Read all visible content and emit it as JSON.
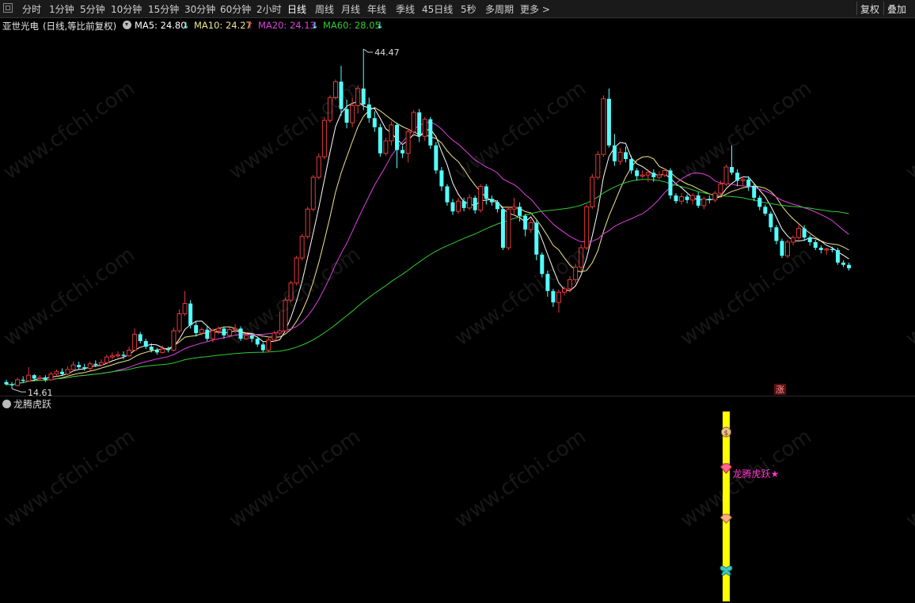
{
  "toolbar": {
    "periods": [
      "分时",
      "1分钟",
      "5分钟",
      "10分钟",
      "15分钟",
      "30分钟",
      "60分钟",
      "2小时",
      "日线",
      "周线",
      "月线",
      "年线",
      "季线",
      "45日线",
      "5秒",
      "多周期"
    ],
    "active": "日线",
    "more": "更多 >",
    "right_buttons": [
      "复权",
      "叠加"
    ]
  },
  "legend": {
    "stock": "亚世光电",
    "mode": "(日线,等比前复权)",
    "ma": [
      {
        "label": "MA5: 24.80",
        "arrow": "↓",
        "color": "#ffffff"
      },
      {
        "label": "MA10: 24.27",
        "arrow": "↑",
        "color": "#f0e68c",
        "arrow_color": "#ff4d4d"
      },
      {
        "label": "MA20: 24.13",
        "arrow": "↓",
        "color": "#e040e0"
      },
      {
        "label": "MA60: 28.05",
        "arrow": "↓",
        "color": "#33cc33"
      }
    ]
  },
  "annotations": {
    "high_label": "44.47",
    "low_label": "14.61",
    "zhang_badge": "涨"
  },
  "indicator": {
    "title": "龙腾虎跃",
    "signal_label": "龙腾虎跃★",
    "signal_color": "#ff33cc",
    "bar_color": "#ffff00",
    "icons": [
      "money-bag-icon",
      "gem-icon",
      "gem-icon",
      "butterfly-icon"
    ]
  },
  "watermark": "www.cfchi.com",
  "colors": {
    "up": "#e53a3a",
    "down": "#54ffff",
    "bg": "#000000"
  },
  "chart_data": {
    "type": "candlestick",
    "ylim": [
      14,
      46
    ],
    "candles": [
      [
        15.2,
        15.0,
        15.4,
        14.9
      ],
      [
        15.0,
        14.9,
        15.2,
        14.61
      ],
      [
        14.9,
        15.4,
        15.6,
        14.8
      ],
      [
        15.4,
        15.3,
        15.7,
        15.1
      ],
      [
        15.3,
        15.8,
        16.5,
        15.2
      ],
      [
        15.8,
        15.5,
        15.9,
        15.3
      ],
      [
        15.5,
        15.6,
        15.8,
        15.3
      ],
      [
        15.6,
        15.4,
        15.8,
        15.2
      ],
      [
        15.4,
        15.9,
        16.1,
        15.3
      ],
      [
        15.9,
        16.1,
        16.3,
        15.7
      ],
      [
        16.1,
        15.9,
        16.4,
        15.8
      ],
      [
        15.9,
        16.3,
        16.6,
        15.8
      ],
      [
        16.3,
        16.7,
        17.0,
        16.1
      ],
      [
        16.7,
        16.5,
        17.0,
        16.3
      ],
      [
        16.5,
        16.4,
        16.8,
        16.2
      ],
      [
        16.4,
        16.8,
        17.0,
        16.2
      ],
      [
        16.8,
        16.7,
        17.1,
        16.5
      ],
      [
        16.7,
        16.9,
        17.2,
        16.6
      ],
      [
        16.9,
        17.4,
        17.6,
        16.8
      ],
      [
        17.4,
        17.5,
        17.8,
        17.2
      ],
      [
        17.5,
        17.6,
        17.9,
        17.3
      ],
      [
        17.6,
        17.5,
        17.9,
        17.2
      ],
      [
        17.5,
        18.0,
        18.3,
        17.4
      ],
      [
        18.0,
        19.4,
        19.9,
        17.9
      ],
      [
        19.4,
        18.8,
        19.6,
        18.6
      ],
      [
        18.8,
        18.3,
        19.0,
        18.1
      ],
      [
        18.3,
        18.0,
        18.6,
        17.8
      ],
      [
        18.0,
        17.8,
        18.2,
        17.6
      ],
      [
        17.8,
        18.1,
        18.4,
        17.7
      ],
      [
        18.1,
        18.0,
        18.3,
        17.8
      ],
      [
        18.0,
        19.7,
        20.0,
        17.9
      ],
      [
        19.7,
        21.2,
        21.6,
        19.5
      ],
      [
        21.2,
        22.1,
        23.2,
        21.0
      ],
      [
        22.1,
        20.2,
        22.4,
        19.9
      ],
      [
        20.2,
        19.5,
        20.5,
        19.2
      ],
      [
        19.5,
        19.8,
        20.0,
        19.3
      ],
      [
        19.8,
        19.0,
        20.1,
        18.8
      ],
      [
        19.0,
        19.7,
        19.9,
        18.7
      ],
      [
        19.7,
        19.9,
        20.1,
        19.4
      ],
      [
        19.9,
        19.3,
        20.1,
        19.0
      ],
      [
        19.3,
        19.8,
        20.0,
        19.1
      ],
      [
        19.8,
        19.9,
        20.3,
        19.5
      ],
      [
        19.9,
        19.0,
        20.1,
        18.8
      ],
      [
        19.0,
        19.3,
        19.6,
        18.9
      ],
      [
        19.3,
        19.0,
        19.5,
        18.7
      ],
      [
        19.0,
        18.5,
        19.2,
        18.3
      ],
      [
        18.5,
        18.0,
        18.7,
        17.8
      ],
      [
        18.0,
        18.9,
        19.2,
        17.8
      ],
      [
        18.9,
        19.5,
        19.7,
        18.7
      ],
      [
        19.5,
        19.7,
        21.4,
        19.3
      ],
      [
        19.7,
        22.4,
        22.6,
        19.6
      ],
      [
        22.4,
        23.9,
        24.1,
        22.2
      ],
      [
        23.9,
        26.1,
        26.3,
        23.7
      ],
      [
        26.1,
        28.0,
        28.2,
        25.9
      ],
      [
        28.0,
        30.4,
        30.6,
        27.8
      ],
      [
        30.4,
        33.2,
        33.4,
        30.2
      ],
      [
        33.2,
        35.0,
        35.3,
        33.0
      ],
      [
        35.0,
        38.2,
        38.5,
        34.8
      ],
      [
        38.2,
        40.2,
        40.4,
        38.0
      ],
      [
        40.2,
        41.6,
        41.8,
        40.0
      ],
      [
        41.6,
        39.2,
        43.0,
        38.6
      ],
      [
        39.2,
        38.0,
        40.0,
        37.5
      ],
      [
        38.0,
        39.5,
        40.2,
        37.6
      ],
      [
        39.5,
        41.0,
        41.3,
        38.8
      ],
      [
        41.0,
        39.6,
        44.47,
        39.1
      ],
      [
        39.6,
        38.4,
        40.2,
        38.0
      ],
      [
        38.4,
        37.6,
        39.0,
        37.2
      ],
      [
        37.6,
        35.3,
        37.9,
        35.0
      ],
      [
        35.3,
        36.4,
        36.7,
        35.1
      ],
      [
        36.4,
        37.8,
        38.1,
        36.0
      ],
      [
        37.8,
        35.6,
        38.0,
        34.0
      ],
      [
        35.6,
        35.3,
        36.0,
        34.9
      ],
      [
        35.3,
        37.2,
        37.5,
        34.5
      ],
      [
        37.2,
        38.9,
        39.1,
        36.8
      ],
      [
        38.9,
        36.8,
        39.2,
        36.3
      ],
      [
        36.8,
        38.3,
        38.5,
        36.4
      ],
      [
        38.3,
        36.0,
        38.5,
        35.7
      ],
      [
        36.0,
        33.8,
        36.3,
        33.5
      ],
      [
        33.8,
        32.4,
        34.1,
        32.0
      ],
      [
        32.4,
        31.0,
        32.6,
        30.7
      ],
      [
        31.0,
        30.2,
        31.3,
        29.9
      ],
      [
        30.2,
        31.1,
        31.4,
        30.0
      ],
      [
        31.1,
        30.5,
        31.4,
        30.2
      ],
      [
        30.5,
        31.4,
        31.7,
        30.3
      ],
      [
        31.4,
        30.3,
        31.6,
        30.0
      ],
      [
        30.3,
        32.4,
        32.6,
        30.1
      ],
      [
        32.4,
        31.3,
        32.6,
        30.8
      ],
      [
        31.3,
        31.0,
        31.6,
        30.7
      ],
      [
        31.0,
        30.4,
        31.2,
        30.1
      ],
      [
        30.4,
        27.0,
        30.6,
        26.8
      ],
      [
        27.0,
        30.4,
        30.6,
        26.8
      ],
      [
        30.4,
        30.6,
        31.4,
        29.8
      ],
      [
        30.6,
        29.8,
        31.0,
        29.3
      ],
      [
        29.8,
        28.6,
        30.0,
        28.0
      ],
      [
        28.6,
        29.2,
        29.5,
        28.3
      ],
      [
        29.2,
        26.4,
        29.4,
        25.9
      ],
      [
        26.4,
        24.7,
        26.6,
        24.4
      ],
      [
        24.7,
        23.2,
        25.0,
        22.7
      ],
      [
        23.2,
        22.2,
        23.4,
        21.8
      ],
      [
        22.2,
        23.1,
        23.3,
        21.3
      ],
      [
        23.1,
        23.4,
        23.6,
        22.8
      ],
      [
        23.4,
        24.2,
        24.5,
        23.1
      ],
      [
        24.2,
        25.3,
        25.6,
        23.9
      ],
      [
        25.3,
        27.0,
        27.3,
        24.9
      ],
      [
        27.0,
        30.6,
        30.8,
        26.8
      ],
      [
        30.6,
        33.2,
        33.5,
        30.4
      ],
      [
        33.2,
        35.2,
        35.5,
        33.0
      ],
      [
        35.2,
        40.1,
        40.4,
        35.0
      ],
      [
        40.1,
        36.0,
        41.0,
        35.8
      ],
      [
        36.0,
        34.6,
        37.0,
        34.2
      ],
      [
        34.6,
        35.4,
        35.8,
        34.3
      ],
      [
        35.4,
        34.8,
        35.9,
        34.5
      ],
      [
        34.8,
        33.8,
        35.1,
        33.5
      ],
      [
        33.8,
        33.3,
        34.0,
        32.9
      ],
      [
        33.3,
        33.4,
        33.8,
        33.1
      ],
      [
        33.4,
        33.6,
        33.9,
        32.8
      ],
      [
        33.6,
        33.2,
        33.9,
        32.8
      ],
      [
        33.2,
        33.4,
        33.7,
        33.0
      ],
      [
        33.4,
        33.8,
        34.0,
        33.2
      ],
      [
        33.8,
        31.6,
        34.0,
        31.3
      ],
      [
        31.6,
        31.1,
        31.8,
        30.9
      ],
      [
        31.1,
        31.5,
        31.8,
        30.8
      ],
      [
        31.5,
        31.2,
        31.7,
        30.9
      ],
      [
        31.2,
        31.6,
        31.8,
        30.8
      ],
      [
        31.6,
        30.7,
        31.9,
        30.5
      ],
      [
        30.7,
        31.3,
        31.5,
        30.4
      ],
      [
        31.3,
        31.2,
        31.6,
        30.9
      ],
      [
        31.2,
        31.8,
        32.0,
        31.0
      ],
      [
        31.8,
        32.6,
        32.9,
        31.5
      ],
      [
        32.6,
        34.1,
        34.3,
        32.4
      ],
      [
        34.1,
        33.6,
        36.0,
        33.4
      ],
      [
        33.6,
        32.9,
        33.9,
        32.4
      ],
      [
        32.9,
        33.0,
        33.3,
        32.4
      ],
      [
        33.0,
        32.4,
        33.3,
        32.0
      ],
      [
        32.4,
        31.4,
        32.6,
        31.1
      ],
      [
        31.4,
        30.6,
        31.6,
        30.3
      ],
      [
        30.6,
        30.0,
        30.8,
        29.8
      ],
      [
        30.0,
        28.8,
        30.2,
        28.4
      ],
      [
        28.8,
        27.6,
        29.0,
        27.3
      ],
      [
        27.6,
        26.3,
        27.8,
        26.1
      ],
      [
        26.3,
        27.5,
        27.7,
        26.1
      ],
      [
        27.5,
        27.9,
        28.1,
        27.2
      ],
      [
        27.9,
        28.7,
        29.0,
        27.7
      ],
      [
        28.7,
        27.9,
        29.0,
        27.6
      ],
      [
        27.9,
        27.5,
        28.1,
        27.2
      ],
      [
        27.5,
        27.0,
        27.7,
        26.8
      ],
      [
        27.0,
        26.8,
        27.2,
        26.5
      ],
      [
        26.8,
        26.9,
        27.0,
        26.4
      ],
      [
        26.9,
        26.8,
        27.1,
        26.6
      ],
      [
        26.8,
        25.7,
        27.0,
        25.5
      ],
      [
        25.7,
        25.5,
        25.9,
        25.3
      ],
      [
        25.5,
        25.2,
        25.7,
        25.0
      ]
    ],
    "ma_periods": [
      5,
      10,
      20,
      60
    ],
    "signal_index": 129
  }
}
